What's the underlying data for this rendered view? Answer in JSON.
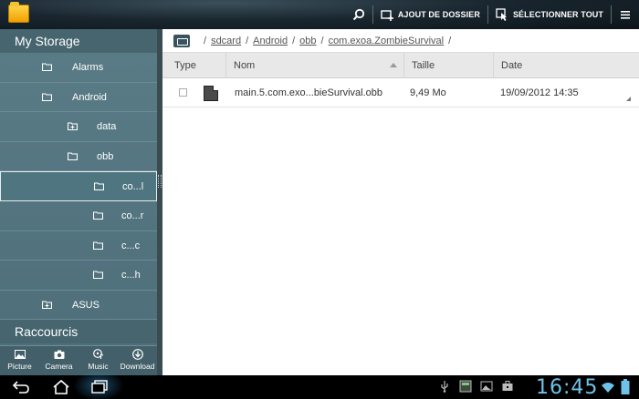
{
  "topbar": {
    "actions": [
      {
        "name": "search",
        "icon": "search-icon",
        "label": ""
      },
      {
        "name": "add-folder",
        "icon": "add-folder-icon",
        "label": "AJOUT DE DOSSIER"
      },
      {
        "name": "select-all",
        "icon": "select-all-icon",
        "label": "SÉLECTIONNER TOUT"
      },
      {
        "name": "overflow-menu",
        "icon": "overflow-menu-icon",
        "label": ""
      }
    ]
  },
  "sidebar": {
    "storage_title": "My Storage",
    "tree": [
      {
        "label": "Alarms",
        "depth": 1,
        "icon": "folder-icon"
      },
      {
        "label": "Android",
        "depth": 1,
        "icon": "folder-icon"
      },
      {
        "label": "data",
        "depth": 2,
        "icon": "folder-plus-icon"
      },
      {
        "label": "obb",
        "depth": 2,
        "icon": "folder-icon"
      },
      {
        "label": "co...l",
        "depth": 3,
        "icon": "folder-icon",
        "selected": true
      },
      {
        "label": "co...r",
        "depth": 3,
        "icon": "folder-icon"
      },
      {
        "label": "c...c",
        "depth": 3,
        "icon": "folder-icon"
      },
      {
        "label": "c...h",
        "depth": 3,
        "icon": "folder-icon"
      },
      {
        "label": "ASUS",
        "depth": 1,
        "icon": "folder-plus-icon"
      }
    ],
    "shortcuts_title": "Raccourcis",
    "tools": [
      {
        "label": "Picture",
        "icon": "picture-icon"
      },
      {
        "label": "Camera",
        "icon": "camera-icon"
      },
      {
        "label": "Music",
        "icon": "music-icon"
      },
      {
        "label": "Download",
        "icon": "download-icon"
      }
    ]
  },
  "breadcrumb": {
    "root_icon": "storage-icon",
    "parts": [
      "sdcard",
      "Android",
      "obb",
      "com.exoa.ZombieSurvival"
    ]
  },
  "table": {
    "columns": {
      "type": "Type",
      "nom": "Nom",
      "taille": "Taille",
      "date": "Date"
    },
    "rows": [
      {
        "nom": "main.5.com.exo...bieSurvival.obb",
        "taille": "9,49 Mo",
        "date": "19/09/2012 14:35"
      }
    ]
  },
  "system": {
    "clock": "16:45",
    "colors": {
      "clock": "#6fc3e8",
      "sidebar": "#557781",
      "header": "#e8e8e8"
    }
  }
}
